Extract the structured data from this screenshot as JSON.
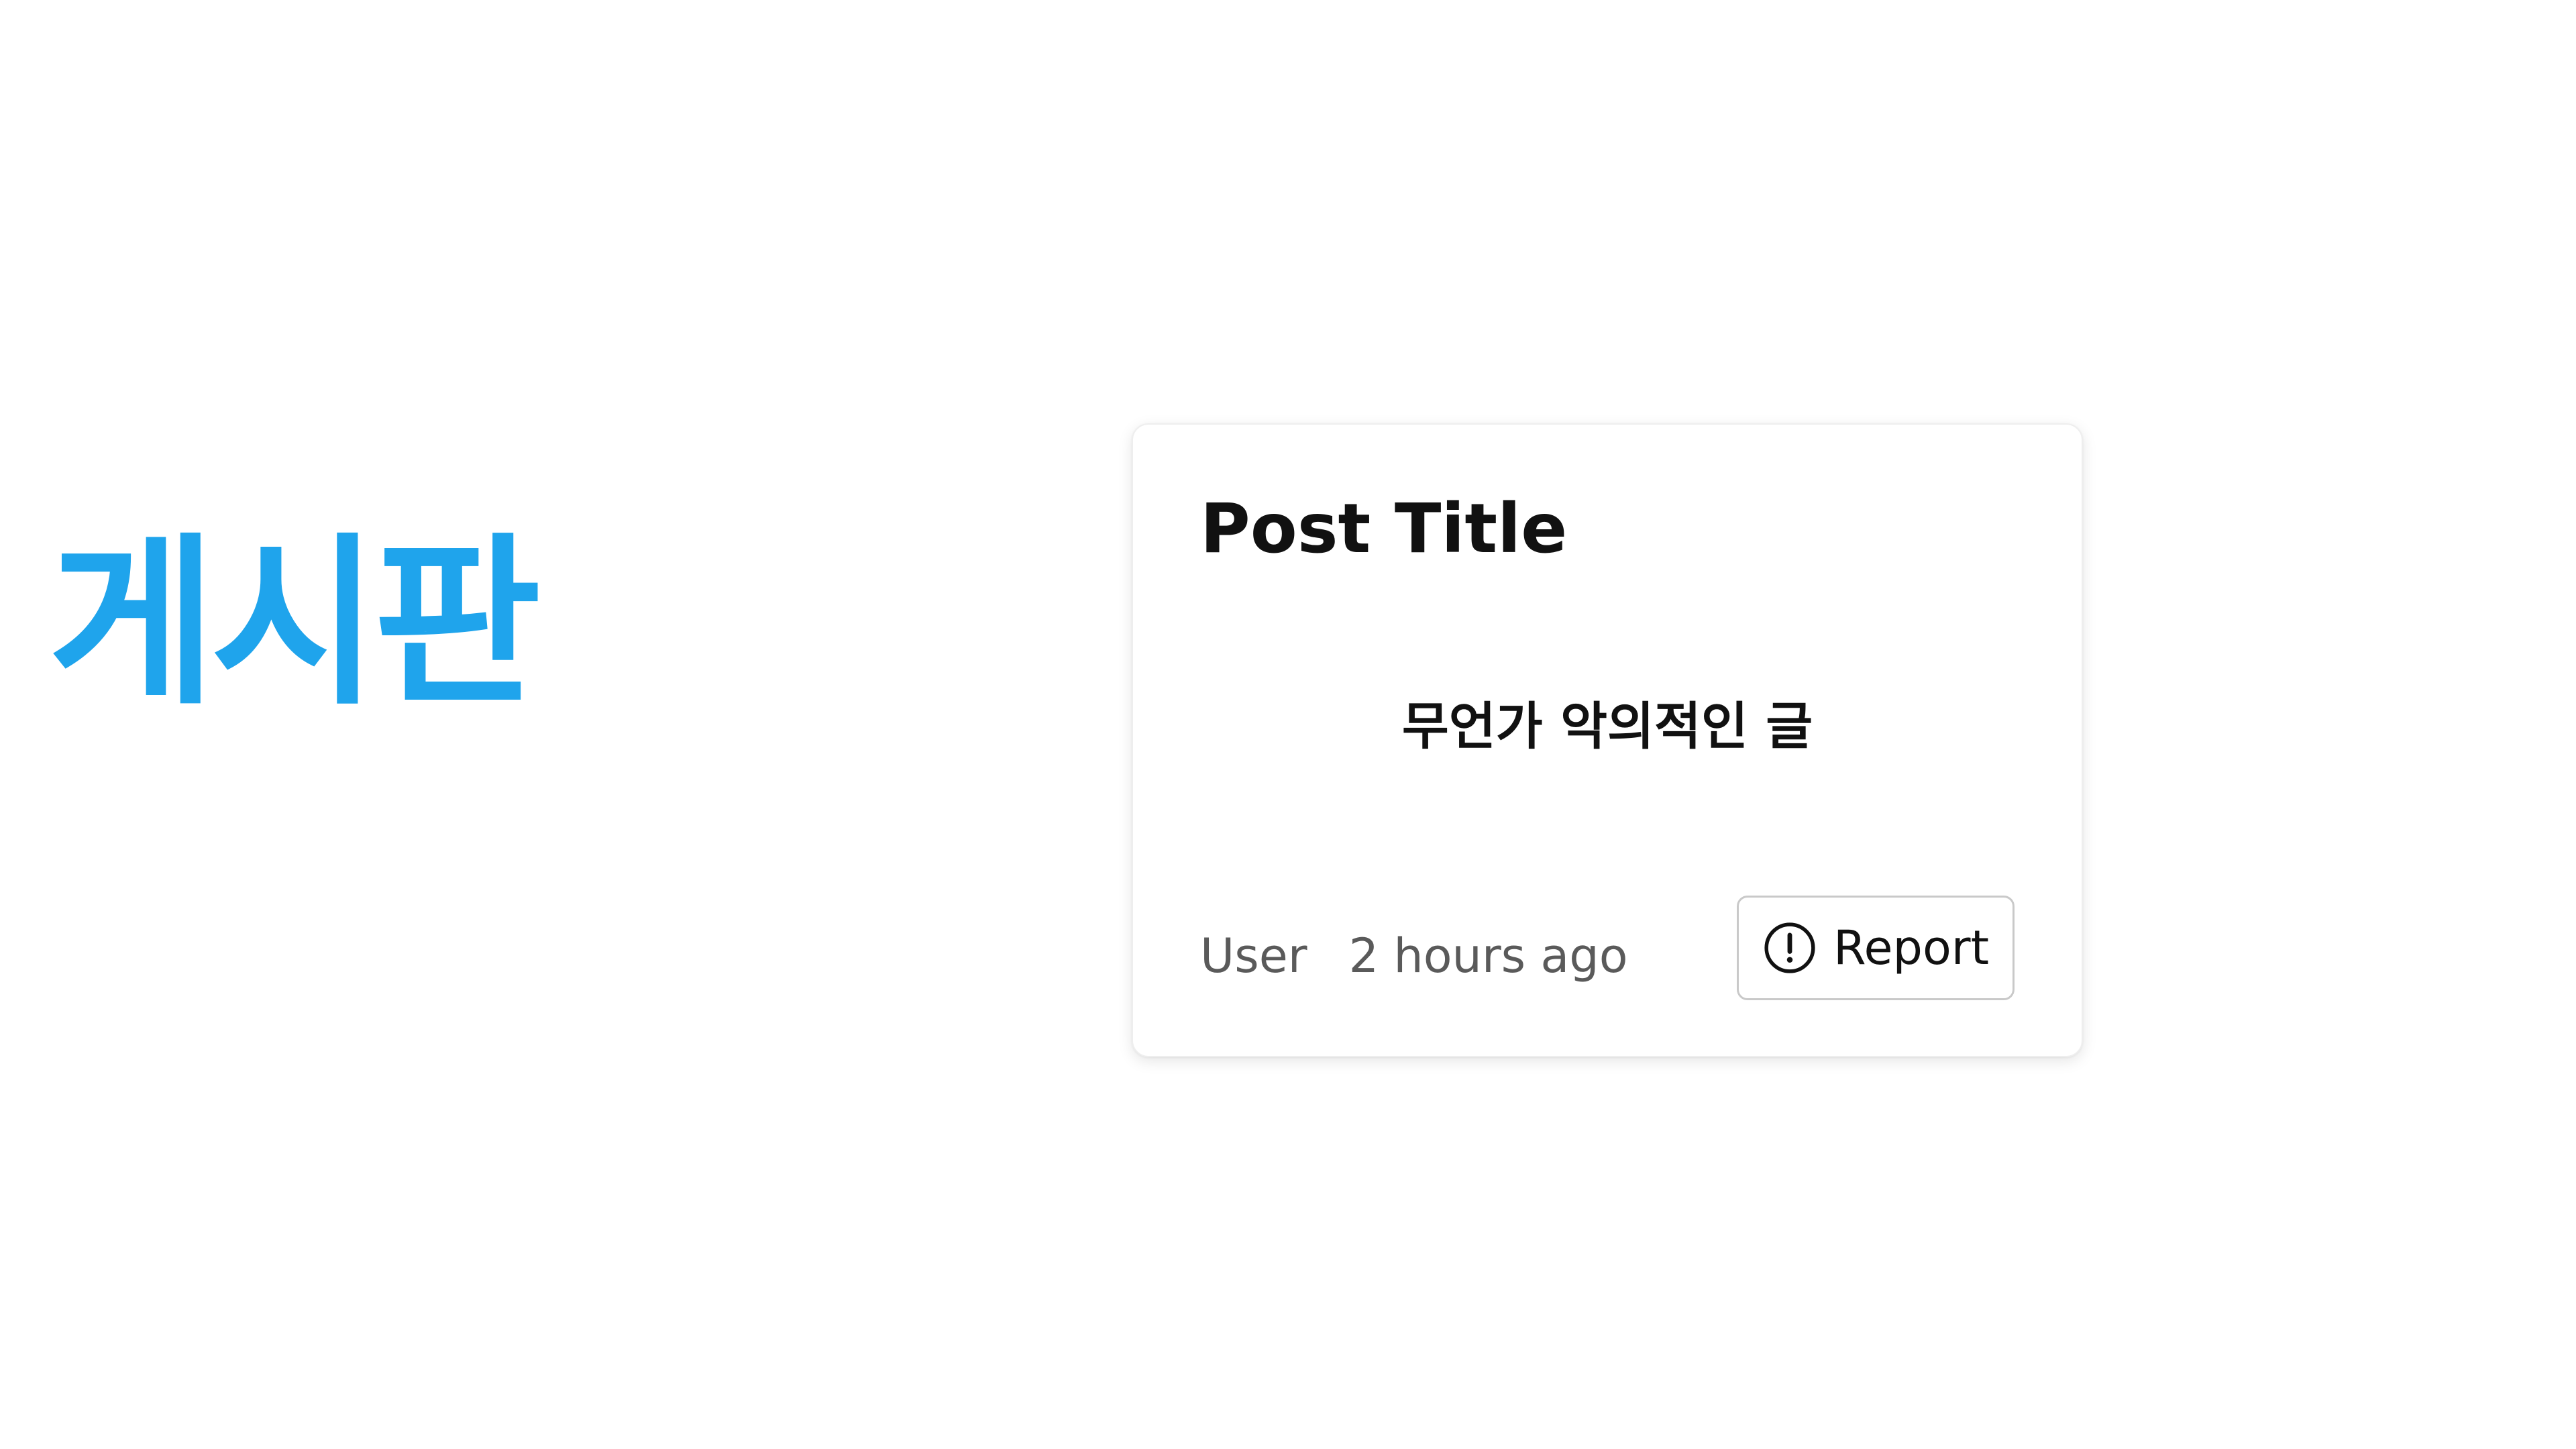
{
  "board": {
    "title": "게시판",
    "accent_color": "#1fa4ec"
  },
  "post": {
    "title": "Post Title",
    "body": "무언가 악의적인 글",
    "author": "User",
    "timestamp": "2 hours ago"
  },
  "report": {
    "label": "Report",
    "icon": "alert-circle-icon"
  }
}
